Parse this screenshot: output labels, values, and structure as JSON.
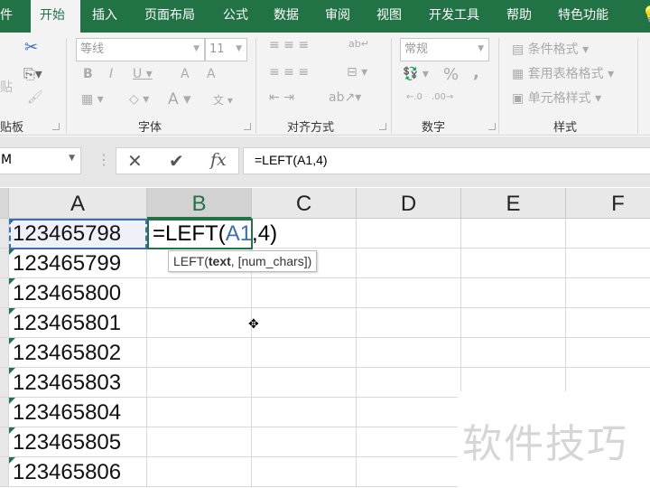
{
  "tabs": [
    "件",
    "开始",
    "插入",
    "页面布局",
    "公式",
    "数据",
    "审阅",
    "视图",
    "开发工具",
    "帮助",
    "特色功能"
  ],
  "ribbon": {
    "clipboard_label": "贴板",
    "paste_partial": "贴",
    "font": {
      "name": "等线",
      "size": "11",
      "label": "字体"
    },
    "alignment_label": "对齐方式",
    "number": {
      "format": "常规",
      "label": "数字",
      "percent": "%",
      "comma": ","
    },
    "styles": {
      "conditional": "条件格式",
      "table": "套用表格格式",
      "cell": "单元格样式",
      "label": "样式"
    }
  },
  "name_box": "M",
  "formula": "=LEFT(A1,4)",
  "columns": [
    "A",
    "B",
    "C",
    "D",
    "E",
    "F"
  ],
  "rows": [
    "123465798",
    "123465799",
    "123465800",
    "123465801",
    "123465802",
    "123465803",
    "123465804",
    "123465805",
    "123465806"
  ],
  "edit": {
    "eq": "=LEFT(",
    "ref": "A1",
    "rest": ",4)"
  },
  "tooltip": {
    "fn": "LEFT(",
    "arg": "text",
    "rest": ", [num_chars])"
  },
  "watermark": "软件技巧",
  "colors": {
    "accent": "#217346",
    "ref": "#3a6fb5"
  }
}
